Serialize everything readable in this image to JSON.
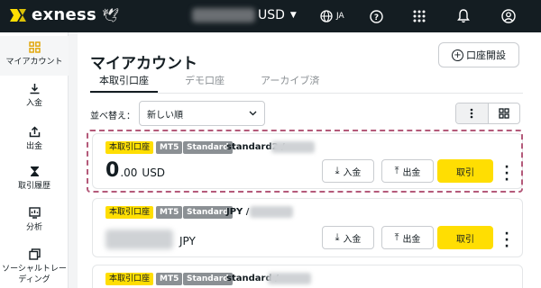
{
  "brand": {
    "name": "exness"
  },
  "header": {
    "currency": "USD",
    "language": "JA"
  },
  "sidebar": {
    "items": [
      {
        "label": "マイアカウント",
        "icon": "grid-icon"
      },
      {
        "label": "入金",
        "icon": "deposit-icon"
      },
      {
        "label": "出金",
        "icon": "withdraw-icon"
      },
      {
        "label": "取引履歴",
        "icon": "hourglass-icon"
      },
      {
        "label": "分析",
        "icon": "analytics-icon"
      },
      {
        "label": "ソーシャルトレーディング",
        "icon": "social-trading-icon"
      }
    ]
  },
  "main": {
    "title": "マイアカウント",
    "open_account_label": "口座開設",
    "tabs": [
      "本取引口座",
      "デモ口座",
      "アーカイブ済"
    ],
    "sort": {
      "label": "並べ替え：",
      "value": "新しい順"
    },
    "accounts": [
      {
        "type_badge": "本取引口座",
        "platform": "MT5",
        "kind": "Standard",
        "name": "standard2 /",
        "balance_int": "0",
        "balance_dec": ".00",
        "currency": "USD"
      },
      {
        "type_badge": "本取引口座",
        "platform": "MT5",
        "kind": "Standard",
        "name": "JPY /",
        "currency": "JPY"
      },
      {
        "type_badge": "本取引口座",
        "platform": "MT5",
        "kind": "Standard",
        "name": "standard /"
      }
    ],
    "actions": {
      "deposit": "入金",
      "withdraw": "出金",
      "trade": "取引"
    }
  },
  "colors": {
    "topbar": "#141d22",
    "accent": "#ffde02",
    "highlight": "#b45a7a"
  }
}
